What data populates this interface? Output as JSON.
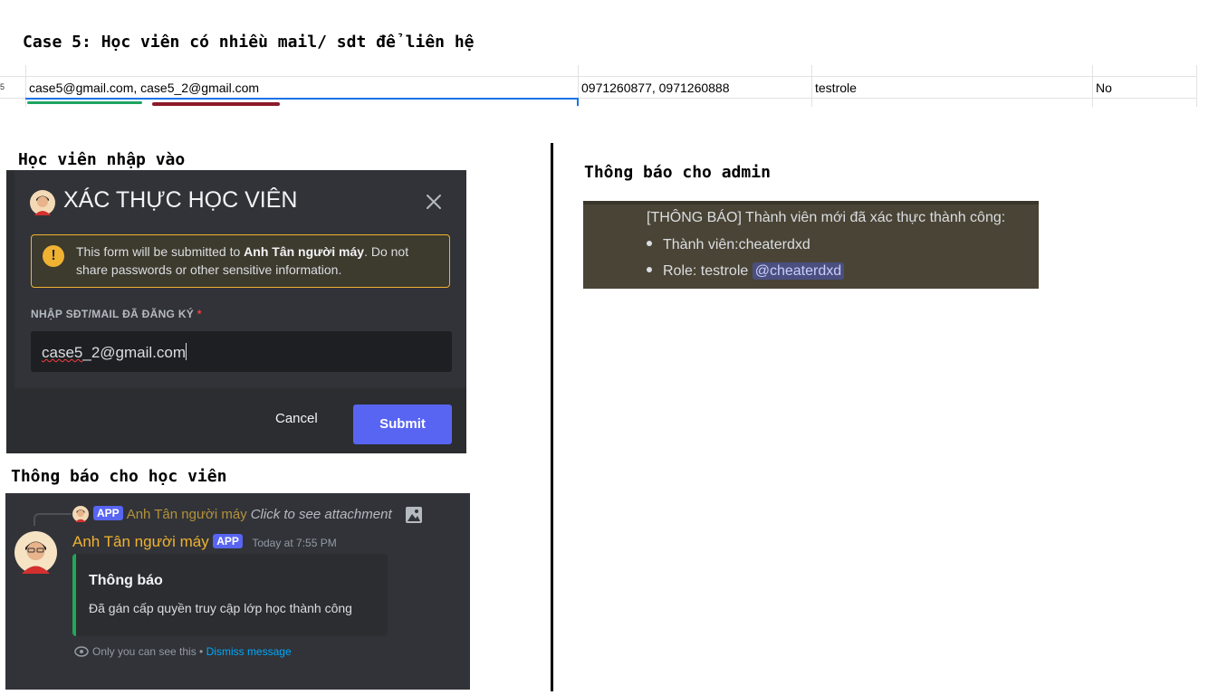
{
  "case_title": "Case 5: Học viên có nhiều mail/ sdt để liên hệ",
  "sheet": {
    "row_number": "5",
    "emails": "case5@gmail.com, case5_2@gmail.com",
    "phones": "0971260877, 0971260888",
    "role": "testrole",
    "flag": "No"
  },
  "labels": {
    "student_input": "Học viên nhập vào",
    "student_notice": "Thông báo cho học viên",
    "admin_notice": "Thông báo cho admin"
  },
  "modal": {
    "title": "XÁC THỰC HỌC VIÊN",
    "warning_prefix": "This form will be submitted to ",
    "warning_bot": "Anh Tân người máy",
    "warning_suffix": ". Do not share passwords or other sensitive information.",
    "field_label": "NHẬP SĐT/MAIL ĐÃ ĐĂNG KÝ",
    "field_required": "*",
    "field_value_part1": "case5",
    "field_value_part2": "_2@gmail.com",
    "cancel_label": "Cancel",
    "submit_label": "Submit"
  },
  "student_message": {
    "app_tag": "APP",
    "reply_author": "Anh Tân người máy",
    "reply_hint": "Click to see attachment",
    "author": "Anh Tân người máy",
    "time": "Today at 7:55 PM",
    "embed_title": "Thông báo",
    "embed_desc": "Đã gán cấp quyền truy cập lớp học thành công",
    "ephemeral_note": "Only you can see this • ",
    "dismiss": "Dismiss message"
  },
  "admin_message": {
    "heading": "[THÔNG BÁO] Thành viên mới đã xác thực thành công:",
    "member_line": "Thành viên:cheaterdxd",
    "role_line": "Role: testrole",
    "mention": "@cheaterdxd"
  },
  "colors": {
    "discord_bg": "#313338",
    "blurple": "#5865f2",
    "warning": "#f0b232",
    "success": "#23a55a",
    "link": "#00a8fc"
  },
  "icons": [
    "close-icon",
    "warning-icon",
    "image-icon",
    "eye-icon",
    "avatar"
  ]
}
